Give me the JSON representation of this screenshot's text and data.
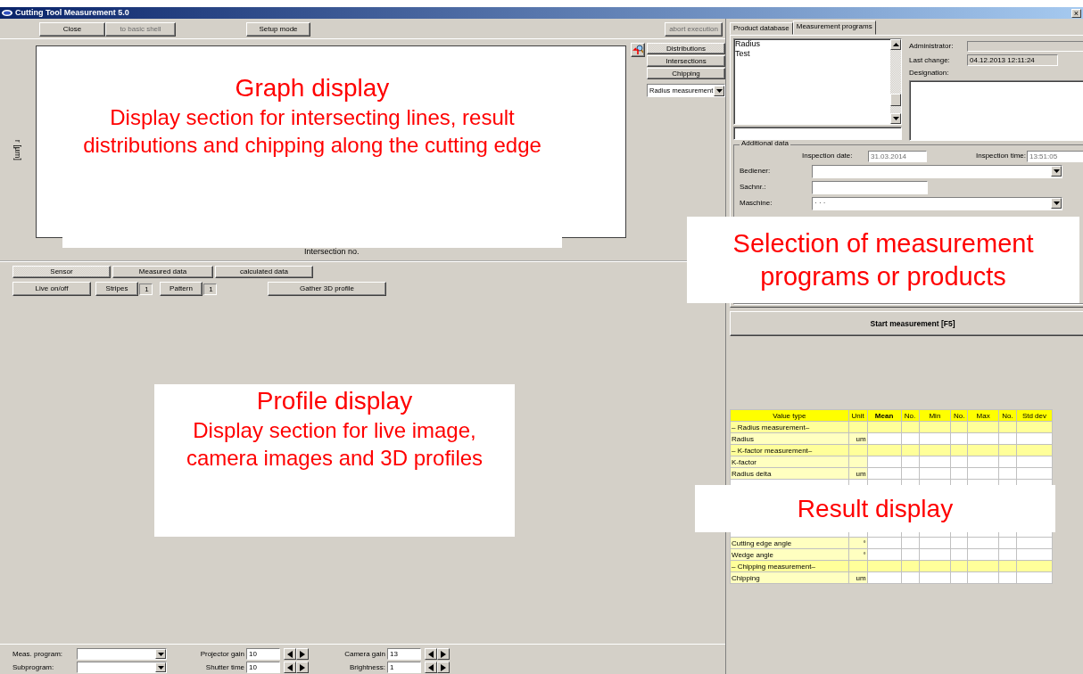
{
  "window": {
    "title": "Cutting Tool Measurement 5.0",
    "close": "×"
  },
  "toolbar": [
    {
      "label": "Close",
      "disabled": false
    },
    {
      "label": "to basic shell",
      "disabled": true
    },
    {
      "label": "Setup mode",
      "disabled": false
    },
    {
      "label": "abort execution",
      "disabled": true
    }
  ],
  "graph": {
    "y_axis_label": "r [µm]",
    "x_axis_label": "Intersection no.",
    "views": [
      {
        "label": "Distributions",
        "selected": true
      },
      {
        "label": "Intersections",
        "selected": false
      },
      {
        "label": "Chipping",
        "selected": false
      }
    ],
    "measurement_select": {
      "value": "Radius measurement"
    }
  },
  "profile": {
    "tabs": [
      {
        "label": "Sensor",
        "selected": true
      },
      {
        "label": "Measured data",
        "selected": false
      },
      {
        "label": "calculated data",
        "selected": false
      }
    ],
    "controls": [
      {
        "kind": "button",
        "label": "Live on/off"
      },
      {
        "kind": "counter",
        "label": "Stripes",
        "value": "1"
      },
      {
        "kind": "counter",
        "label": "Pattern",
        "value": "1"
      },
      {
        "kind": "button",
        "label": "Gather 3D profile"
      }
    ]
  },
  "bottom": {
    "selects": [
      {
        "label": "Meas. program:"
      },
      {
        "label": "Subprogram:"
      }
    ],
    "spinners": [
      {
        "label": "Projector gain",
        "value": "10"
      },
      {
        "label": "Shutter time",
        "value": "10"
      },
      {
        "label": "Camera gain",
        "value": "13"
      },
      {
        "label": "Brightness:",
        "value": "1"
      }
    ]
  },
  "right": {
    "tabs": [
      {
        "label": "Product database",
        "selected": false
      },
      {
        "label": "Measurement programs",
        "selected": true
      }
    ],
    "programs": [
      {
        "label": "Radius"
      },
      {
        "label": "Test"
      }
    ],
    "administrator": {
      "label": "Administrator:"
    },
    "last_change": {
      "label": "Last change:",
      "value": "04.12.2013 12:11:24"
    },
    "designation": {
      "label": "Designation:"
    },
    "additional_data": {
      "title": "Additional data",
      "inspection_date": {
        "label": "Inspection date:",
        "value": "31.03.2014"
      },
      "inspection_time": {
        "label": "Inspection time:",
        "value": "13:51:05"
      },
      "fields": [
        {
          "kind": "combo",
          "label": "Bediener:"
        },
        {
          "kind": "text",
          "label": "Sachnr.:"
        },
        {
          "kind": "combo",
          "label": "Maschine:",
          "value": "· · ·"
        }
      ]
    },
    "start_button": "Start measurement [F5]"
  },
  "results": {
    "columns": [
      {
        "label": "Value type",
        "bold": false
      },
      {
        "label": "Unit",
        "bold": false
      },
      {
        "label": "Mean",
        "bold": true
      },
      {
        "label": "No.",
        "bold": false
      },
      {
        "label": "Min",
        "bold": false
      },
      {
        "label": "No.",
        "bold": false
      },
      {
        "label": "Max",
        "bold": false
      },
      {
        "label": "No.",
        "bold": false
      },
      {
        "label": "Std dev",
        "bold": false
      }
    ],
    "rows": [
      {
        "kind": "section",
        "label": "– Radius measurement–"
      },
      {
        "kind": "value",
        "label": "Radius",
        "unit": "um"
      },
      {
        "kind": "section",
        "label": "– K-factor measurement–"
      },
      {
        "kind": "value",
        "label": "K-factor"
      },
      {
        "kind": "value",
        "label": "Radius delta",
        "unit": "um"
      },
      {
        "kind": "covered"
      },
      {
        "kind": "covered"
      },
      {
        "kind": "covered"
      },
      {
        "kind": "covered"
      },
      {
        "kind": "covered"
      },
      {
        "kind": "value",
        "label": "Cutting edge angle",
        "unit": "°"
      },
      {
        "kind": "value",
        "label": "Wedge angle",
        "unit": "°"
      },
      {
        "kind": "section",
        "label": "– Chipping measurement–"
      },
      {
        "kind": "value",
        "label": "Chipping",
        "unit": "um"
      }
    ]
  },
  "annotations": [
    {
      "title": "Graph display",
      "text": "Display section for intersecting lines, result distributions and chipping along the cutting edge"
    },
    {
      "title": "Profile display",
      "text": "Display section for live image, camera images and 3D profiles"
    },
    {
      "title": "Selection of measurement programs or products"
    },
    {
      "title": "Result display"
    }
  ]
}
